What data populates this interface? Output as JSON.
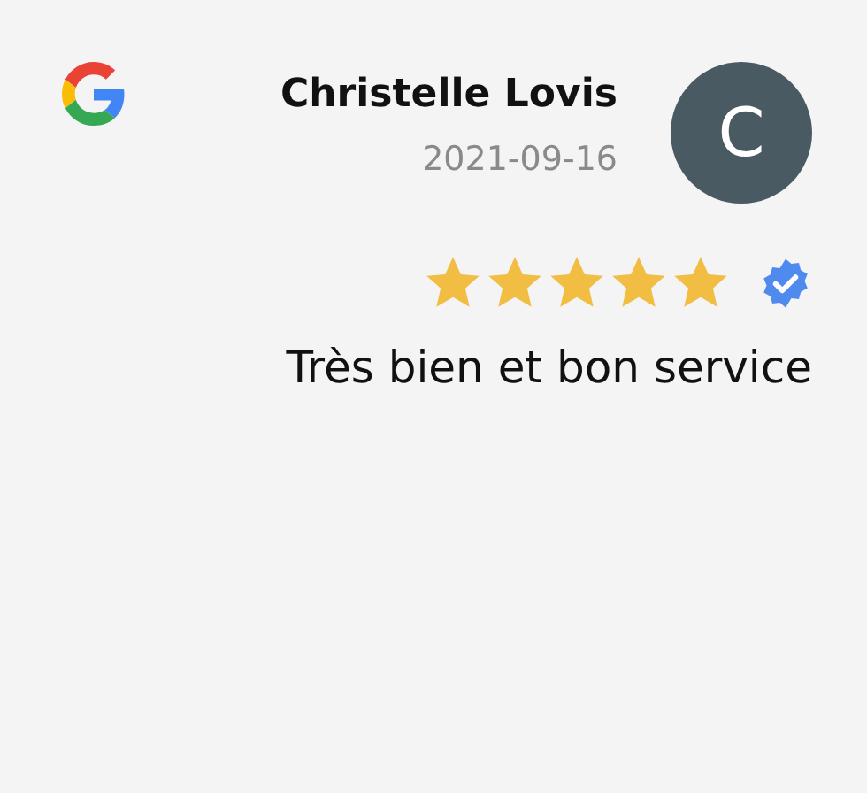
{
  "review": {
    "author": "Christelle Lovis",
    "date": "2021-09-16",
    "avatar_letter": "C",
    "stars": 5,
    "verified": true,
    "text": "Très bien et bon service"
  }
}
